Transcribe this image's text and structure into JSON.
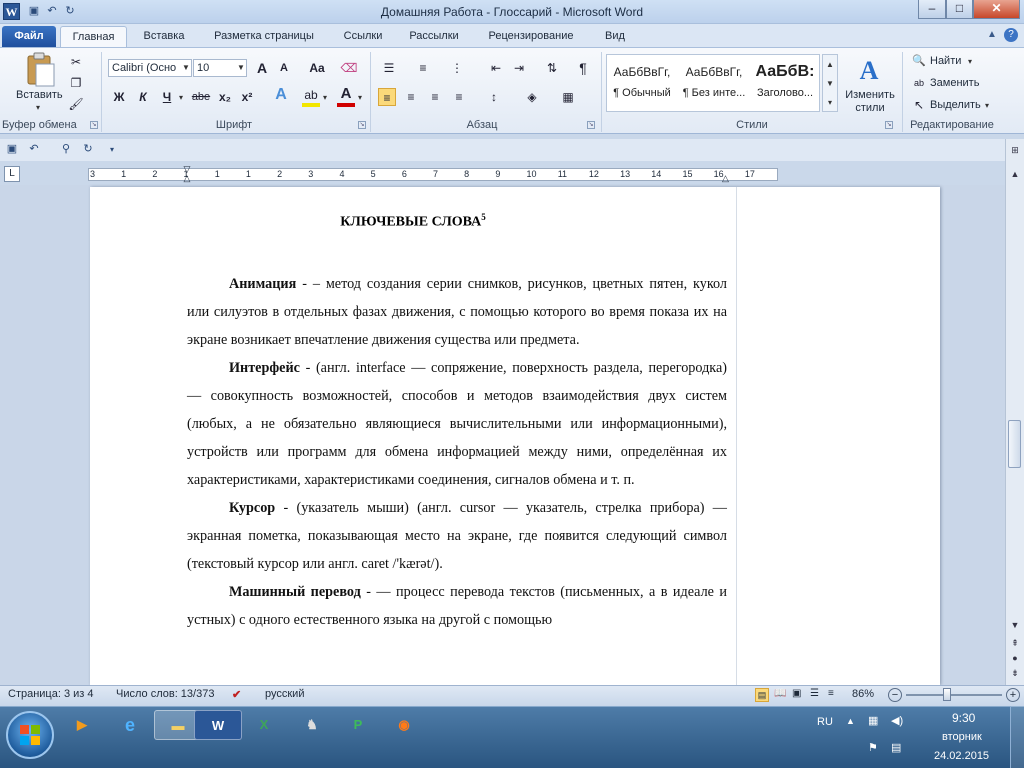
{
  "window": {
    "title": "Домашняя Работа - Глоссарий - Microsoft Word",
    "app_logo": "W",
    "controls": {
      "minimize": "–",
      "maximize": "□",
      "close": "✕"
    }
  },
  "ribbon_tabs": {
    "file": "Файл",
    "items": [
      "Главная",
      "Вставка",
      "Разметка страницы",
      "Ссылки",
      "Рассылки",
      "Рецензирование",
      "Вид"
    ],
    "active": "Главная"
  },
  "clipboard": {
    "paste": "Вставить",
    "label": "Буфер обмена"
  },
  "font": {
    "name": "Calibri (Осно",
    "size": "10",
    "grow": "A",
    "shrink": "A",
    "case": "Aa",
    "bold": "Ж",
    "italic": "К",
    "underline": "Ч",
    "strike": "abe",
    "subscript": "x₂",
    "superscript": "x²",
    "color_glyph": "A",
    "highlight_color": "#f2e600",
    "font_color": "#d00000",
    "label": "Шрифт"
  },
  "paragraph": {
    "label": "Абзац",
    "pilcrow": "¶"
  },
  "styles": {
    "items": [
      {
        "sample": "АаБбВвГг,",
        "name": "¶ Обычный"
      },
      {
        "sample": "АаБбВвГг,",
        "name": "¶ Без инте..."
      },
      {
        "sample": "АаБбВ:",
        "name": "Заголово..."
      }
    ],
    "change": "Изменить стили",
    "label": "Стили"
  },
  "editing": {
    "find": "Найти",
    "replace": "Заменить",
    "select": "Выделить",
    "label": "Редактирование"
  },
  "ruler": {
    "marks": [
      "3",
      "1",
      "2",
      "1",
      "1",
      "1",
      "2",
      "3",
      "4",
      "5",
      "6",
      "7",
      "8",
      "9",
      "10",
      "11",
      "12",
      "13",
      "14",
      "15",
      "16",
      "17"
    ]
  },
  "document": {
    "heading": "КЛЮЧЕВЫЕ СЛОВА",
    "heading_sup": "5",
    "entries": [
      {
        "term": "Анимация",
        "text": " - – метод создания серии снимков, рисунков, цветных пятен, кукол или силуэтов в отдельных фазах движения, с помощью которого во время показа их на экране возникает впечатление движения существа или предмета."
      },
      {
        "term": "Интерфейс",
        "text": " - (англ. interface — сопряжение, поверхность раздела, перегородка) — совокупность возможностей, способов и методов взаимодействия двух систем (любых, а не обязательно являющиеся вычислительными или информационными), устройств или программ для обмена информацией между ними, определённая их характеристиками, характеристиками соединения, сигналов обмена и т. п."
      },
      {
        "term": "Курсор",
        "text": " - (указатель мыши) (англ. cursor — указатель, стрелка прибора) — экранная пометка, показывающая место на экране, где появится следующий символ (текстовый курсор или англ. caret /'kærət/)."
      },
      {
        "term": "Машинный перевод",
        "text": " - — процесс перевода текстов (письменных, а в идеале и устных) с одного естественного языка на другой с помощью"
      }
    ]
  },
  "status": {
    "page": "Страница: 3 из 4",
    "words": "Число слов: 13/373",
    "language": "русский",
    "zoom": "86%",
    "zoom_minus": "−",
    "zoom_plus": "+"
  },
  "taskbar": {
    "lang": "RU",
    "time": "9:30",
    "day": "вторник",
    "date": "24.02.2015"
  }
}
